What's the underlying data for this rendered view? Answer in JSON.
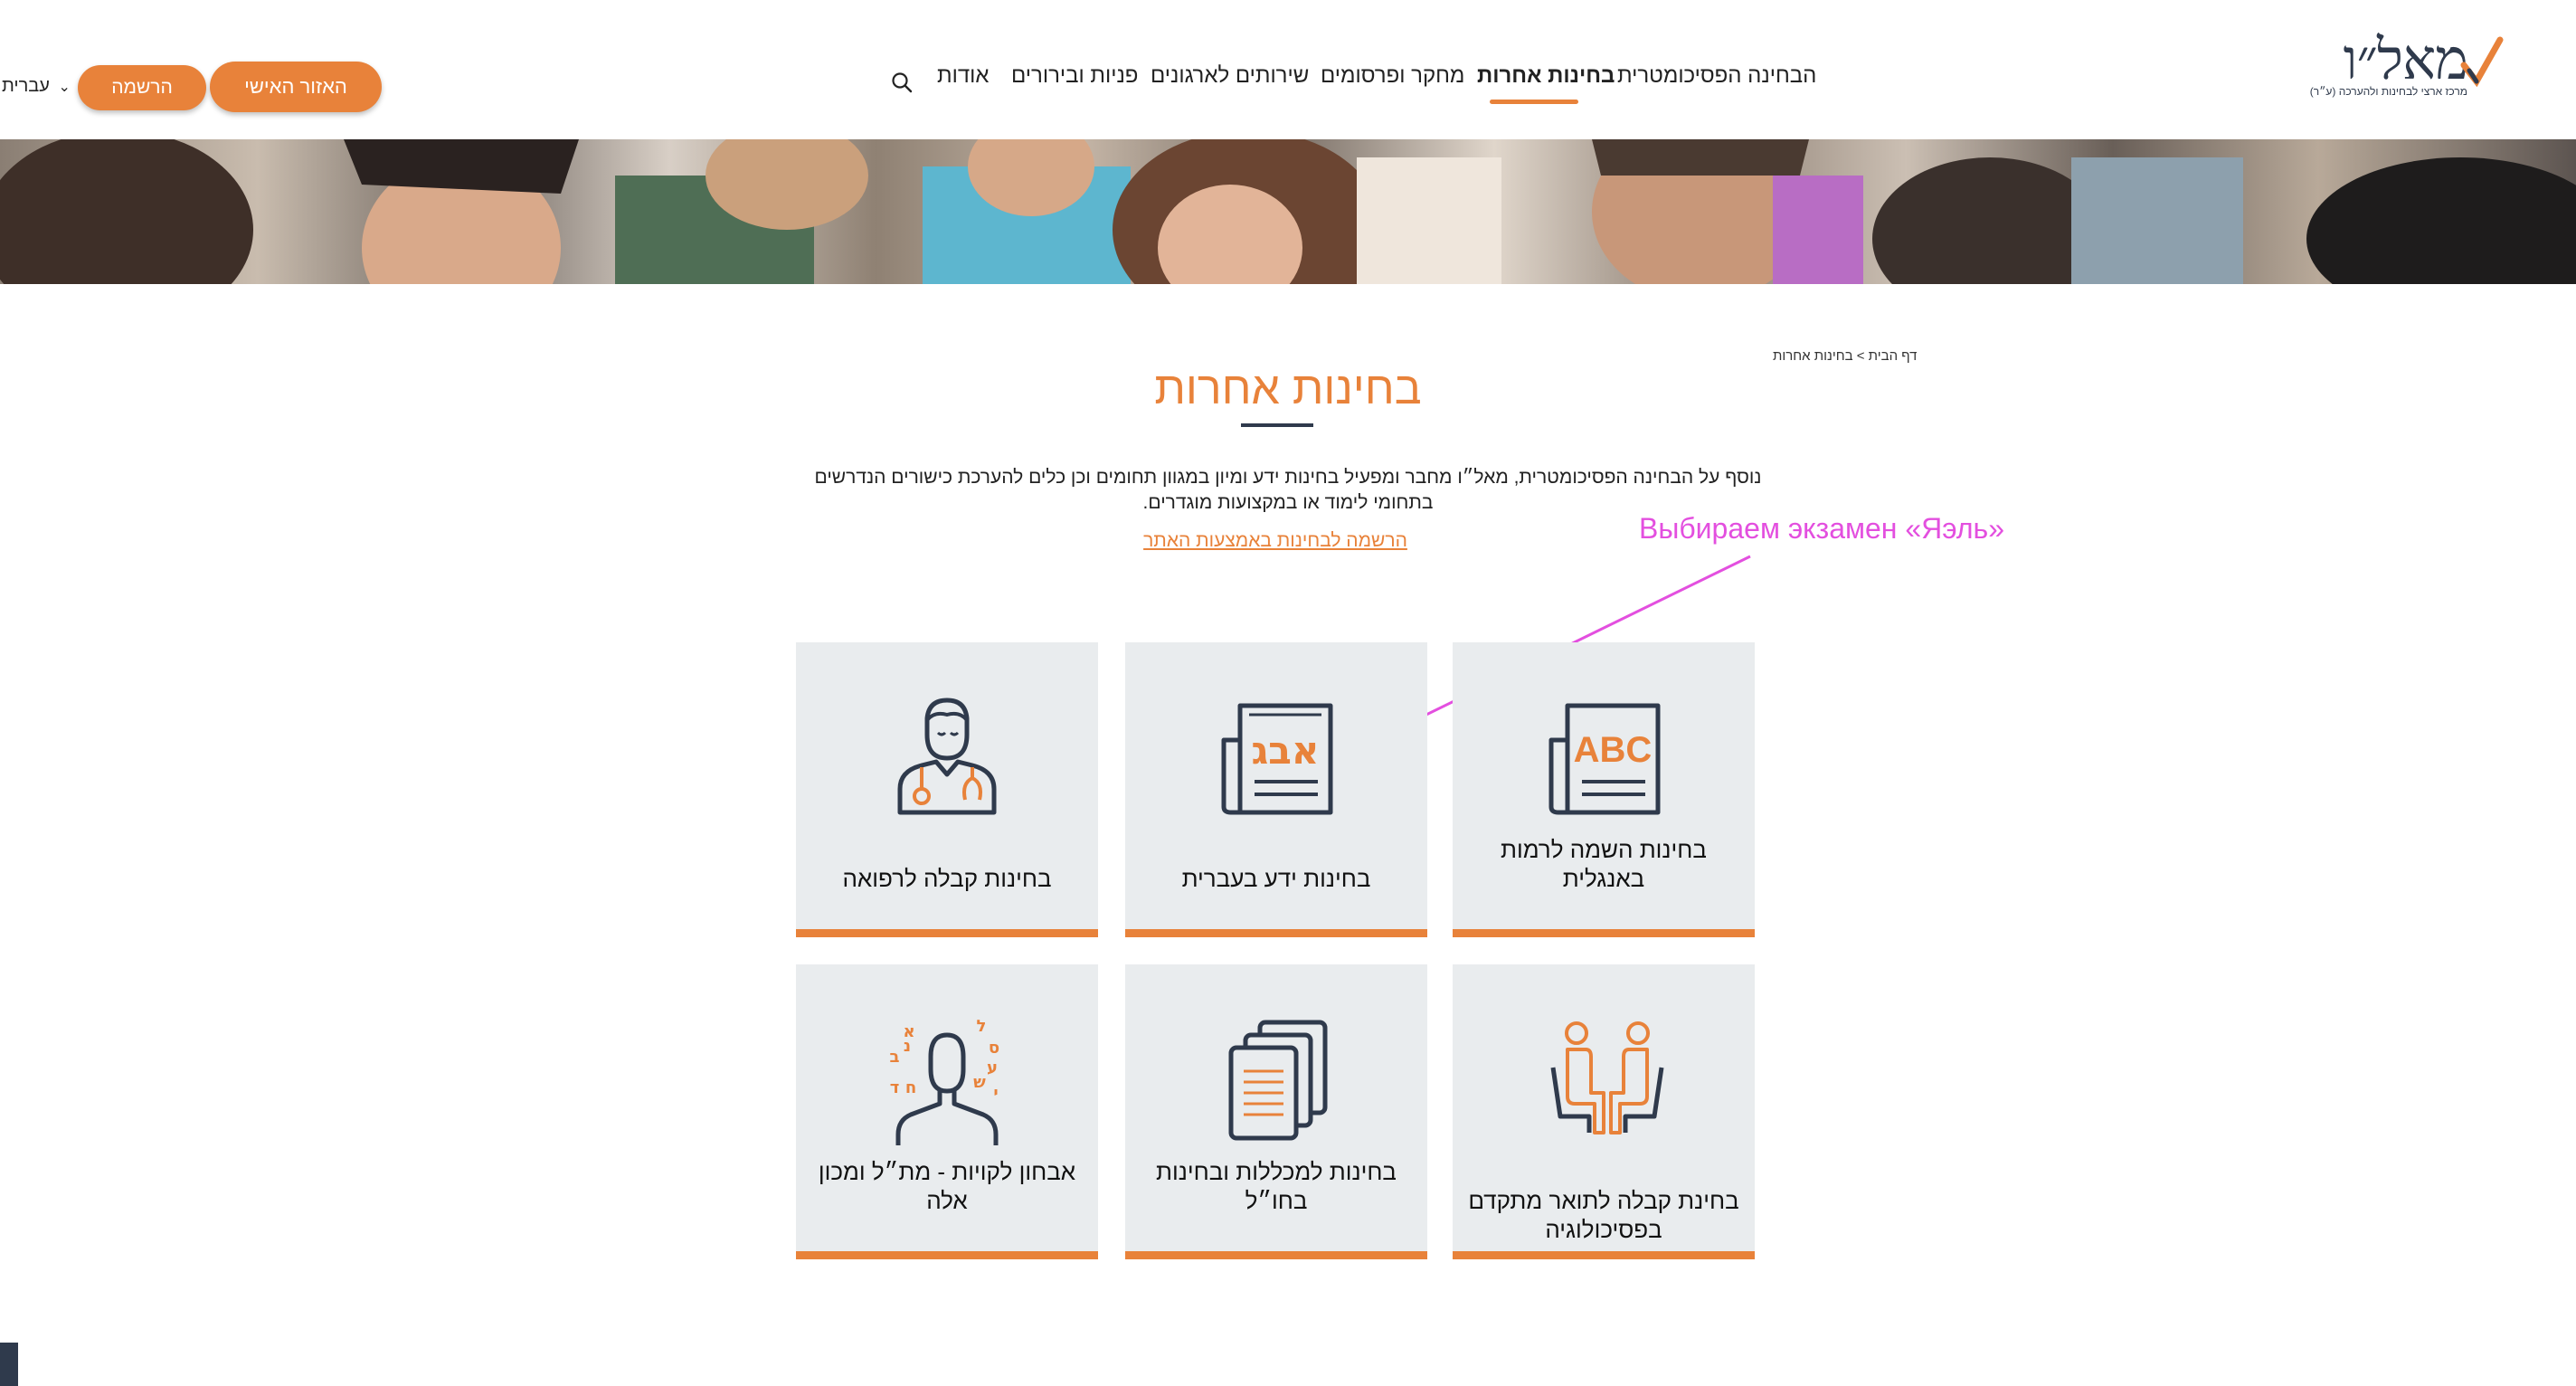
{
  "header": {
    "logo_text": "מאל״ו",
    "logo_subtitle": "מרכז ארצי לבחינות ולהערכה (ע״ר)",
    "nav": [
      {
        "label": "הבחינה הפסיכומטרית",
        "active": false
      },
      {
        "label": "בחינות אחרות",
        "active": true
      },
      {
        "label": "מחקר ופרסומים",
        "active": false
      },
      {
        "label": "שירותים לארגונים",
        "active": false
      },
      {
        "label": "פניות ובירורים",
        "active": false
      },
      {
        "label": "אודות",
        "active": false
      }
    ],
    "personal_area_label": "האזור האישי",
    "register_label": "הרשמה לבחינות",
    "language_label": "עברית",
    "accent_color": "#e8823a"
  },
  "breadcrumb": "דף הבית > בחינות אחרות",
  "page": {
    "title": "בחינות אחרות",
    "intro": "נוסף על הבחינה הפסיכומטרית, מאל״ו מחבר ומפעיל בחינות ידע ומיון במגוון תחומים וכן כלים להערכת כישורים הנדרשים בתחומי לימוד או במקצועות מוגדרים.",
    "register_link": "הרשמה לבחינות באמצעות האתר"
  },
  "annotation": "Выбираем экзамен «Яэль»",
  "cards": [
    {
      "label": "בחינות השמה לרמות באנגלית",
      "icon": "abc-document-icon",
      "icon_text": "ABC"
    },
    {
      "label": "בחינות ידע בעברית",
      "icon": "hebrew-document-icon",
      "icon_text": "אבג"
    },
    {
      "label": "בחינות קבלה לרפואה",
      "icon": "doctor-icon"
    },
    {
      "label": "בחינת קבלה לתואר מתקדם בפסיכולוגיה",
      "icon": "two-people-chairs-icon"
    },
    {
      "label": "בחינות למכללות ובחינות בחו״ל",
      "icon": "stacked-documents-icon"
    },
    {
      "label": "אבחון לקויות - מת״ל ומכון אלה",
      "icon": "person-letters-icon",
      "icon_letters": [
        "א",
        "ל",
        "ס",
        "ב",
        "נ",
        "ע",
        "ש",
        "ד",
        "ח",
        "י"
      ]
    }
  ]
}
